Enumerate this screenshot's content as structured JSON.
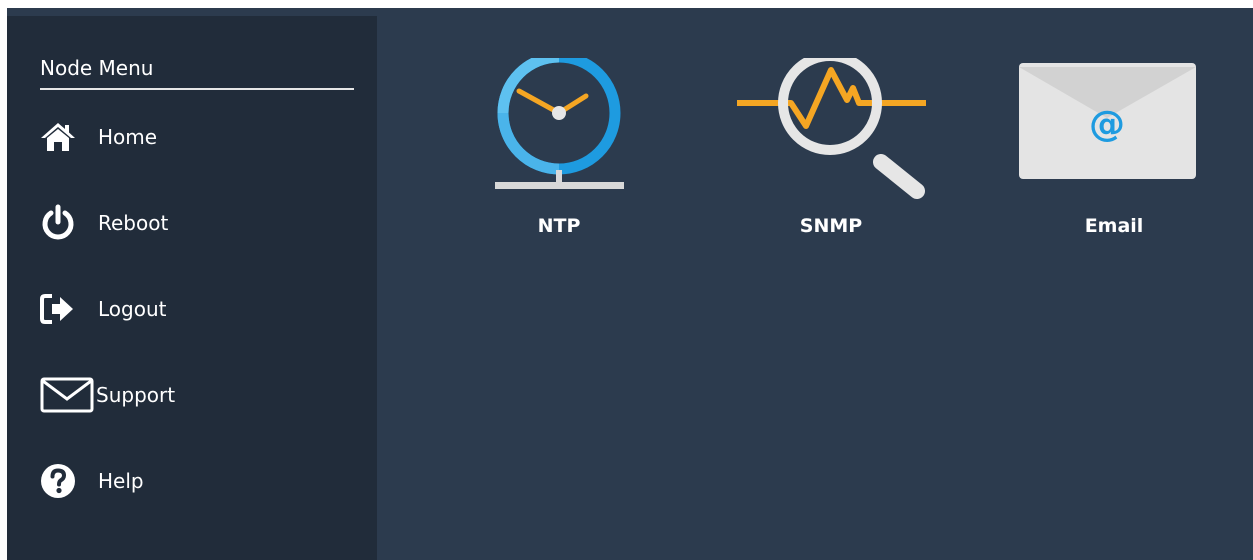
{
  "sidebar": {
    "title": "Node Menu",
    "items": [
      {
        "label": "Home",
        "icon": "home-icon"
      },
      {
        "label": "Reboot",
        "icon": "power-icon"
      },
      {
        "label": "Logout",
        "icon": "logout-icon"
      },
      {
        "label": "Support",
        "icon": "envelope-icon"
      },
      {
        "label": "Help",
        "icon": "help-icon"
      }
    ]
  },
  "tiles": [
    {
      "label": "NTP",
      "icon": "clock-icon"
    },
    {
      "label": "SNMP",
      "icon": "magnifier-pulse-icon"
    },
    {
      "label": "Email",
      "icon": "email-envelope-icon"
    }
  ],
  "colors": {
    "background": "#2c3b4e",
    "sidebar": "#212c3a",
    "accent_blue": "#1e9be0",
    "accent_orange": "#f5a623"
  }
}
